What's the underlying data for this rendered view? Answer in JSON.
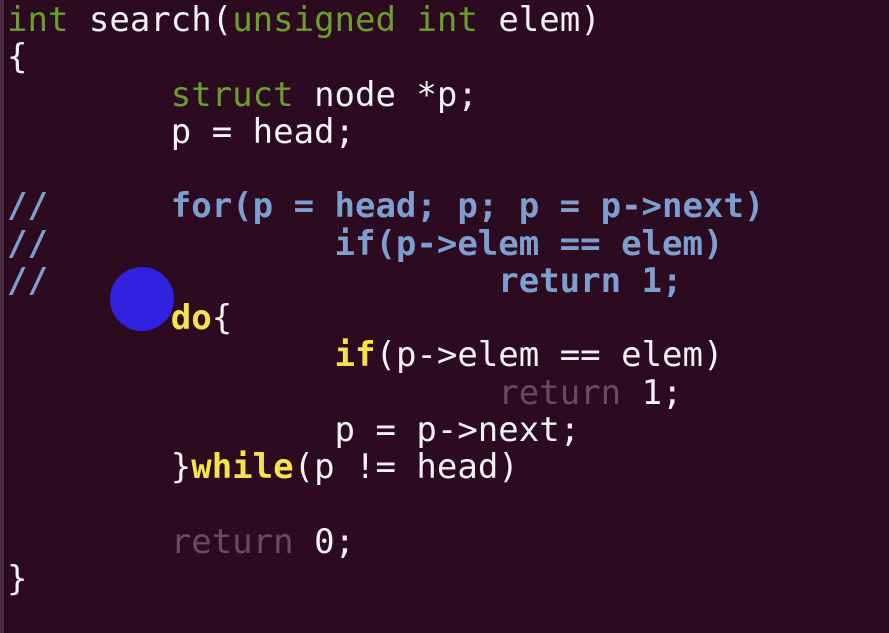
{
  "editor": {
    "colors": {
      "background": "#2c0a20",
      "plain": "#f2f2f2",
      "type": "#6aa02a",
      "comment": "#7c9fcf",
      "keyword": "#f4e34a",
      "dim": "#6a4a62",
      "pointer": "#3122e0"
    },
    "lines": [
      {
        "tokens": [
          {
            "text": "int",
            "style": "type"
          },
          {
            "text": " search(",
            "style": "plain"
          },
          {
            "text": "unsigned",
            "style": "type"
          },
          {
            "text": " ",
            "style": "plain"
          },
          {
            "text": "int",
            "style": "type"
          },
          {
            "text": " elem)",
            "style": "plain"
          }
        ]
      },
      {
        "tokens": [
          {
            "text": "{",
            "style": "plain"
          }
        ]
      },
      {
        "tokens": [
          {
            "text": "        ",
            "style": "plain"
          },
          {
            "text": "struct",
            "style": "type"
          },
          {
            "text": " node *p;",
            "style": "plain"
          }
        ]
      },
      {
        "tokens": [
          {
            "text": "        p = head;",
            "style": "plain"
          }
        ]
      },
      {
        "tokens": []
      },
      {
        "tokens": [
          {
            "text": "//      for(p = head; p; p = p->next)",
            "style": "comment"
          }
        ]
      },
      {
        "tokens": [
          {
            "text": "//              if(p->elem == elem)",
            "style": "comment"
          }
        ]
      },
      {
        "tokens": [
          {
            "text": "//                      return 1;",
            "style": "comment"
          }
        ]
      },
      {
        "tokens": [
          {
            "text": "        ",
            "style": "plain"
          },
          {
            "text": "do",
            "style": "keyword"
          },
          {
            "text": "{",
            "style": "plain"
          }
        ]
      },
      {
        "tokens": [
          {
            "text": "                ",
            "style": "plain"
          },
          {
            "text": "if",
            "style": "keyword"
          },
          {
            "text": "(p->elem == elem)",
            "style": "plain"
          }
        ]
      },
      {
        "tokens": [
          {
            "text": "                        ",
            "style": "plain"
          },
          {
            "text": "return",
            "style": "dim"
          },
          {
            "text": " 1;",
            "style": "plain"
          }
        ]
      },
      {
        "tokens": [
          {
            "text": "                p = p->next;",
            "style": "plain"
          }
        ]
      },
      {
        "tokens": [
          {
            "text": "        }",
            "style": "plain"
          },
          {
            "text": "while",
            "style": "keyword"
          },
          {
            "text": "(p != head)",
            "style": "plain"
          }
        ]
      },
      {
        "tokens": []
      },
      {
        "tokens": [
          {
            "text": "        ",
            "style": "plain"
          },
          {
            "text": "return",
            "style": "dim"
          },
          {
            "text": " 0;",
            "style": "plain"
          }
        ]
      },
      {
        "tokens": [
          {
            "text": "}",
            "style": "plain"
          }
        ]
      }
    ]
  }
}
